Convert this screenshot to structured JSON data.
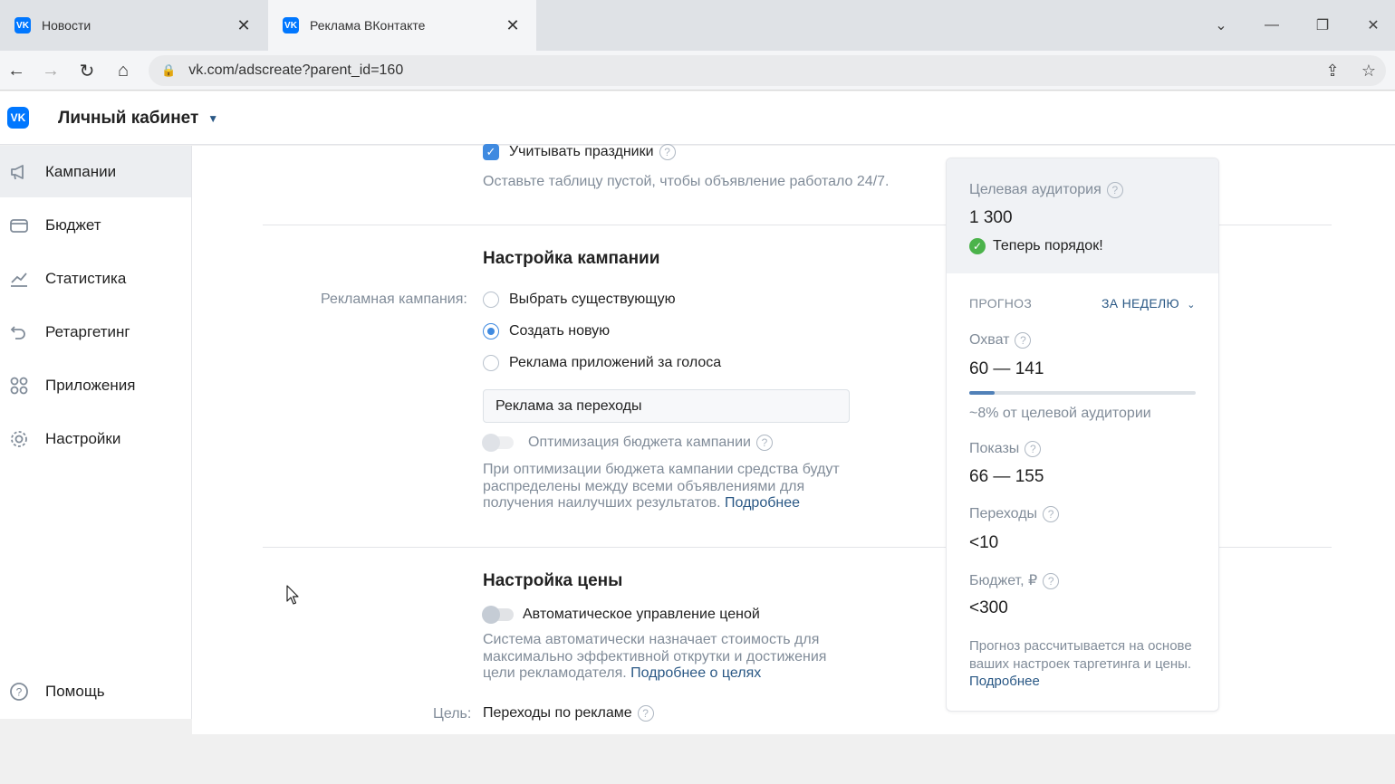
{
  "browser": {
    "tabs": [
      {
        "title": "Новости",
        "active": false
      },
      {
        "title": "Реклама ВКонтакте",
        "active": true
      }
    ],
    "url": "vk.com/adscreate?parent_id=160"
  },
  "header": {
    "cabinet_label": "Личный кабинет"
  },
  "sidebar": {
    "items": [
      {
        "label": "Кампании",
        "icon": "megaphone-icon",
        "selected": true
      },
      {
        "label": "Бюджет",
        "icon": "wallet-icon"
      },
      {
        "label": "Статистика",
        "icon": "chart-icon"
      },
      {
        "label": "Ретаргетинг",
        "icon": "retarget-icon"
      },
      {
        "label": "Приложения",
        "icon": "apps-icon"
      },
      {
        "label": "Настройки",
        "icon": "gear-icon"
      }
    ],
    "help_label": "Помощь"
  },
  "schedule": {
    "holidays_label": "Учитывать праздники",
    "holidays_checked": true,
    "hint": "Оставьте таблицу пустой, чтобы объявление работало 24/7."
  },
  "campaign": {
    "title": "Настройка кампании",
    "field_label": "Рекламная кампания:",
    "options": [
      {
        "label": "Выбрать существующую",
        "selected": false
      },
      {
        "label": "Создать новую",
        "selected": true
      },
      {
        "label": "Реклама приложений за голоса",
        "selected": false
      }
    ],
    "name_value": "Реклама за переходы",
    "budget_opt_label": "Оптимизация бюджета кампании",
    "budget_opt_hint": "При оптимизации бюджета кампании средства будут распределены между всеми объявлениями для получения наилучших результатов.",
    "more_link": "Подробнее"
  },
  "price": {
    "title": "Настройка цены",
    "auto_label": "Автоматическое управление ценой",
    "auto_hint": "Система автоматически назначает стоимость для максимально эффективной открутки и достижения цели рекламодателя.",
    "goals_link": "Подробнее о целях",
    "goal_label": "Цель:",
    "goal_value": "Переходы по рекламе"
  },
  "forecast": {
    "audience_label": "Целевая аудитория",
    "audience_value": "1 300",
    "status": "Теперь порядок!",
    "forecast_label": "ПРОГНОЗ",
    "period": "ЗА НЕДЕЛЮ",
    "reach_label": "Охват",
    "reach_value": "60 — 141",
    "reach_share": 0.08,
    "reach_note": "~8% от целевой аудитории",
    "impressions_label": "Показы",
    "impressions_value": "66 — 155",
    "clicks_label": "Переходы",
    "clicks_value": "<10",
    "budget_label": "Бюджет, ₽",
    "budget_value": "<300",
    "note": "Прогноз рассчитывается на основе ваших настроек таргетинга и цены.",
    "more_link": "Подробнее"
  },
  "colors": {
    "vk_blue": "#0077ff",
    "link": "#2a5885",
    "accent": "#3f8ae0",
    "success": "#4bb34b"
  }
}
